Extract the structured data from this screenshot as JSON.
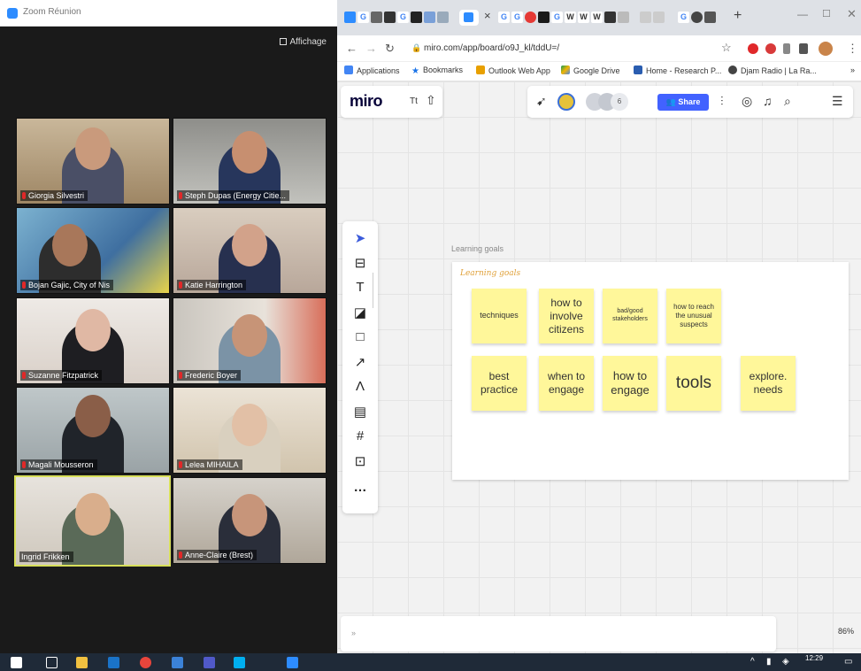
{
  "zoom": {
    "title": "Zoom Réunion",
    "view_label": "Affichage",
    "participants": [
      {
        "name": "Giorgia Silvestri"
      },
      {
        "name": "Steph Dupas (Energy Citie..."
      },
      {
        "name": "Bojan Gajic, City of Nis"
      },
      {
        "name": "Katie Harrington"
      },
      {
        "name": "Suzanne Fitzpatrick"
      },
      {
        "name": "Frederic Boyer"
      },
      {
        "name": "Magali Mousseron"
      },
      {
        "name": "Lelea MIHAILA"
      },
      {
        "name": "Ingrid Frikken"
      },
      {
        "name": "Anne-Claire (Brest)"
      }
    ]
  },
  "chrome": {
    "url": "miro.com/app/board/o9J_kl/tddU=/",
    "tab_close": "×",
    "new_tab": "+",
    "bookmarks": [
      {
        "label": "Applications"
      },
      {
        "label": "Bookmarks"
      },
      {
        "label": "Outlook Web App"
      },
      {
        "label": "Google Drive"
      },
      {
        "label": "Home - Research P..."
      },
      {
        "label": "Djam Radio | La Ra..."
      }
    ]
  },
  "miro": {
    "logo": "miro",
    "board_name": "Tt",
    "share_label": "Share",
    "avatar_count": "6",
    "frame_title": "Learning goals",
    "frame_heading": "Learning goals",
    "stickies": [
      {
        "text": "techniques"
      },
      {
        "text": "how to involve citizens"
      },
      {
        "text": "bad/good stakeholders"
      },
      {
        "text": "how to reach the unusual suspects"
      },
      {
        "text": "best practice"
      },
      {
        "text": "when to engage"
      },
      {
        "text": "how to engage"
      },
      {
        "text": "tools"
      },
      {
        "text": "explore. needs"
      }
    ],
    "zoom_level": "86%"
  },
  "taskbar": {
    "time": "12:29"
  }
}
